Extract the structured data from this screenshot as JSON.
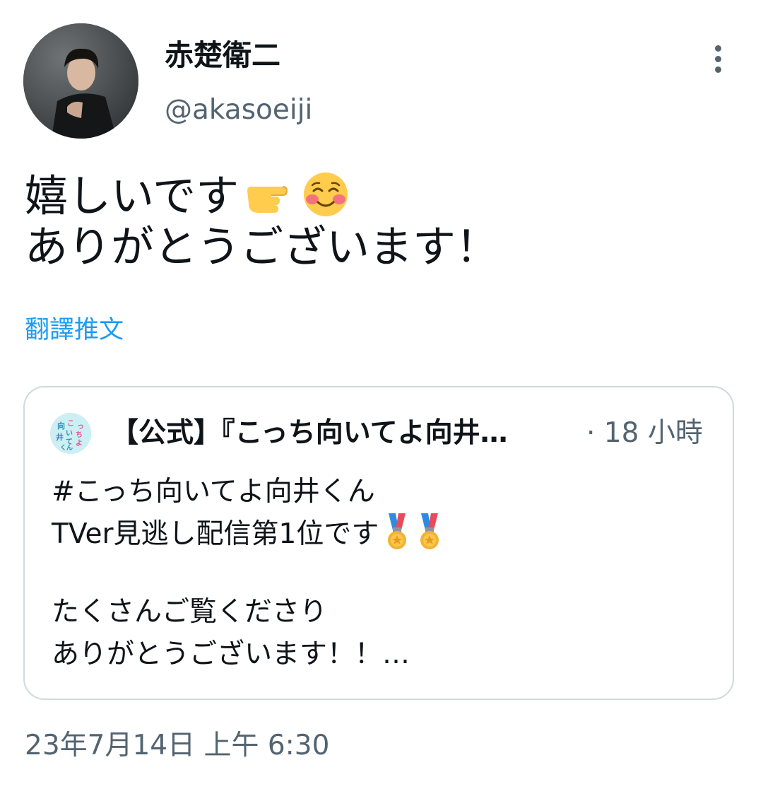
{
  "author": {
    "display_name": "赤楚衛二",
    "handle": "@akasoeiji",
    "avatar_icon": "profile-photo"
  },
  "menu": {
    "icon": "more-vertical-icon"
  },
  "tweet": {
    "line1": "嬉しいです",
    "line1_emojis": [
      "pointing-left-hand-icon",
      "smiling-face-blush-icon"
    ],
    "line2": "ありがとうございます！"
  },
  "translate": {
    "label": "翻譯推文"
  },
  "quoted_tweet": {
    "name": "【公式】『こっち向いてよ向井…",
    "time": "· 18 小時",
    "avatar_text": "向いて こっち 井くん よ",
    "lines": [
      "#こっち向いてよ向井くん",
      "TVer見逃し配信第1位です",
      "",
      "たくさんご覧くださり",
      "ありがとうございます！！…"
    ],
    "line2_emojis": [
      "medal-icon",
      "medal-icon"
    ]
  },
  "timestamp": "23年7月14日 上午 6:30",
  "colors": {
    "text": "#0f1419",
    "secondary": "#536471",
    "link": "#1d9bf0",
    "border": "#cfd9de"
  }
}
